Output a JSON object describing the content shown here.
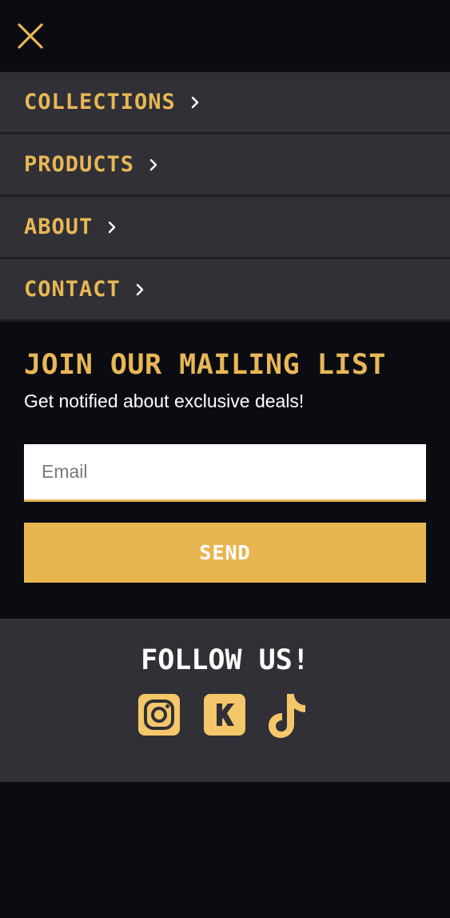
{
  "nav": {
    "items": [
      {
        "label": "COLLECTIONS"
      },
      {
        "label": "PRODUCTS"
      },
      {
        "label": "ABOUT"
      },
      {
        "label": "CONTACT"
      }
    ]
  },
  "mailing": {
    "title": "JOIN OUR MAILING LIST",
    "subtitle": "Get notified about exclusive deals!",
    "email_placeholder": "Email",
    "email_value": "",
    "send_label": "SEND"
  },
  "follow": {
    "title": "FOLLOW US!",
    "icons": [
      "instagram-icon",
      "kickstarter-icon",
      "tiktok-icon"
    ]
  },
  "colors": {
    "background": "#0b0b12",
    "panel": "#303036",
    "accent": "#e8b756",
    "text": "#ffffff"
  }
}
